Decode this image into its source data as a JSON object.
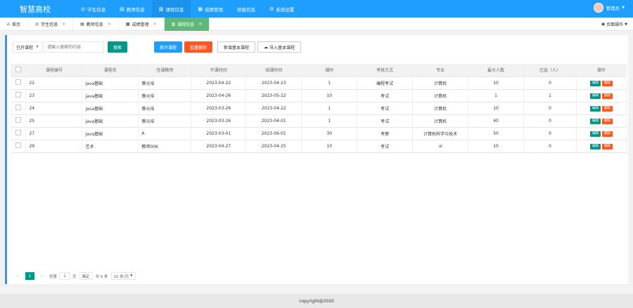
{
  "app": {
    "brand": "智慧高校"
  },
  "nav": [
    {
      "icon": "user-icon",
      "label": "学生信息"
    },
    {
      "icon": "teacher-icon",
      "label": "教师信息"
    },
    {
      "icon": "book-icon",
      "label": "课程信息"
    },
    {
      "icon": "grade-icon",
      "label": "成绩管理"
    },
    {
      "icon": "class-icon",
      "label": "班级信息"
    },
    {
      "icon": "gear-icon",
      "label": "系统设置"
    }
  ],
  "user": {
    "name": "管理员"
  },
  "tabs": [
    {
      "label": "首页"
    },
    {
      "label": "学生信息"
    },
    {
      "label": "教师信息"
    },
    {
      "label": "成绩管理"
    },
    {
      "label": "课程信息"
    }
  ],
  "page_ops": "页面操作",
  "toolbar": {
    "select_value": "已开课程",
    "search_placeholder": "请输入搜索的内容",
    "search_btn": "搜索",
    "new_btn": "新开课程",
    "batch_delete_btn": "批量删除",
    "add_basic_btn": "新增基本课程",
    "import_basic_btn": "导入基本课程"
  },
  "table": {
    "headers": [
      "课程编号",
      "课程名",
      "任课教师",
      "开课时间",
      "结课时间",
      "课时",
      "考核方式",
      "专业",
      "最大人数",
      "已选（人）",
      "操作"
    ],
    "rows": [
      [
        "22",
        "java基础",
        "蔡元培",
        "2023-04-22",
        "2023-04-23",
        "1",
        "编程考试",
        "计算机",
        "10",
        "0"
      ],
      [
        "23",
        "java基础",
        "蔡元培",
        "2023-04-26",
        "2023-05-22",
        "10",
        "考试",
        "计算机",
        "1",
        "1"
      ],
      [
        "24",
        "java基础",
        "蔡元培",
        "2023-03-26",
        "2023-04-22",
        "1",
        "考试",
        "计算机",
        "10",
        "0"
      ],
      [
        "25",
        "java基础",
        "蔡元培",
        "2023-03-26",
        "2023-04-01",
        "1",
        "考试",
        "计算机",
        "40",
        "0"
      ],
      [
        "27",
        "java基础",
        "A",
        "2023-03-01",
        "2023-06-01",
        "30",
        "考察",
        "计算机科学与技术",
        "50",
        "0"
      ],
      [
        "29",
        "艺术",
        "教师006",
        "2023-04-27",
        "2023-04-25",
        "10",
        "考试",
        "ui",
        "10",
        "0"
      ]
    ],
    "edit_label": "编辑",
    "delete_label": "删除"
  },
  "pager": {
    "current": "1",
    "goto_prefix": "到第",
    "goto_value": "1",
    "goto_suffix": "页",
    "confirm": "确定",
    "total": "共 6 条",
    "limit": "10 条/页"
  },
  "footer": "copyright@2020",
  "colors": {
    "primary": "#1e9fff",
    "green": "#009688",
    "red": "#ff5722",
    "tab_active": "#5fb878"
  }
}
